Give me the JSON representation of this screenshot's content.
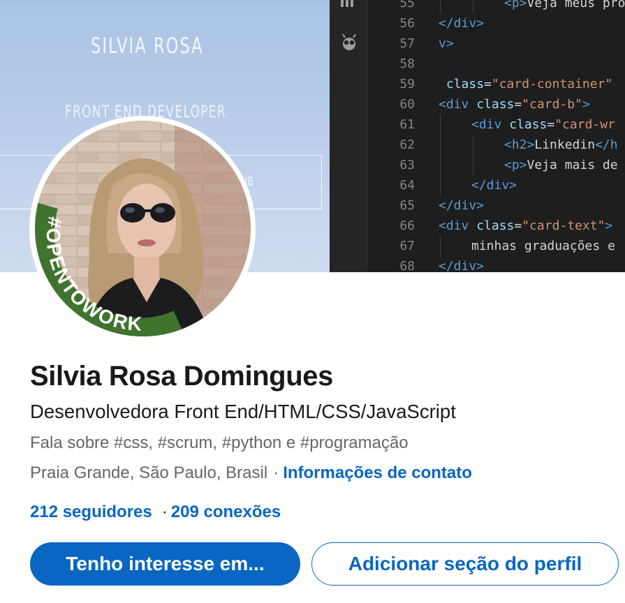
{
  "banner": {
    "name": "SILVIA ROSA",
    "role": "FRONT END DEVELOPER",
    "box_text": "UB",
    "code_lines": [
      {
        "num": "55",
        "indent": 2,
        "parts": [
          [
            "tag",
            "<"
          ],
          [
            "tag",
            "p"
          ],
          [
            "tag",
            ">"
          ],
          [
            "txt",
            "Veja meus projet"
          ]
        ]
      },
      {
        "num": "56",
        "indent": 0,
        "parts": [
          [
            "tag",
            "</div>"
          ]
        ]
      },
      {
        "num": "57",
        "indent": 0,
        "parts": [
          [
            "tag",
            "v>"
          ]
        ]
      },
      {
        "num": "58",
        "indent": 0,
        "parts": []
      },
      {
        "num": "59",
        "indent": 0,
        "parts": [
          [
            "txt",
            " "
          ],
          [
            "attr",
            "class"
          ],
          [
            "txt",
            "="
          ],
          [
            "str",
            "\"card-container\""
          ]
        ]
      },
      {
        "num": "60",
        "indent": 0,
        "parts": [
          [
            "tag",
            "<div "
          ],
          [
            "attr",
            "class"
          ],
          [
            "txt",
            "="
          ],
          [
            "str",
            "\"card-b\""
          ],
          [
            "tag",
            ">"
          ]
        ]
      },
      {
        "num": "61",
        "indent": 1,
        "parts": [
          [
            "tag",
            "<div "
          ],
          [
            "attr",
            "class"
          ],
          [
            "txt",
            "="
          ],
          [
            "str",
            "\"card-wr"
          ]
        ]
      },
      {
        "num": "62",
        "indent": 2,
        "parts": [
          [
            "tag",
            "<h2>"
          ],
          [
            "txt",
            "Linkedin"
          ],
          [
            "tag",
            "</h"
          ]
        ]
      },
      {
        "num": "63",
        "indent": 2,
        "parts": [
          [
            "tag",
            "<p>"
          ],
          [
            "txt",
            "Veja mais de"
          ]
        ]
      },
      {
        "num": "64",
        "indent": 1,
        "parts": [
          [
            "tag",
            "</div>"
          ]
        ]
      },
      {
        "num": "65",
        "indent": 0,
        "parts": [
          [
            "tag",
            "</div>"
          ]
        ]
      },
      {
        "num": "66",
        "indent": 0,
        "parts": [
          [
            "tag",
            "<div "
          ],
          [
            "attr",
            "class"
          ],
          [
            "txt",
            "="
          ],
          [
            "str",
            "\"card-text\""
          ],
          [
            "tag",
            ">"
          ]
        ]
      },
      {
        "num": "67",
        "indent": 1,
        "parts": [
          [
            "txt",
            "minhas graduações e"
          ]
        ]
      },
      {
        "num": "68",
        "indent": 0,
        "parts": [
          [
            "tag",
            "</div>"
          ]
        ]
      }
    ]
  },
  "avatar": {
    "badge_text": "#OPENTOWORK",
    "badge_color": "#40742e"
  },
  "profile": {
    "name": "Silvia Rosa Domingues",
    "headline": "Desenvolvedora Front End/HTML/CSS/JavaScript",
    "topics": "Fala sobre #css, #scrum, #python e #programação",
    "location": "Praia Grande, São Paulo, Brasil",
    "separator": "·",
    "contact_link": "Informações de contato",
    "followers": "212 seguidores",
    "network_separator": "·",
    "connections": "209 conexões"
  },
  "actions": {
    "primary_label": "Tenho interesse em...",
    "secondary_label": "Adicionar seção do perfil"
  },
  "colors": {
    "brand": "#0a66c2",
    "text_primary": "#191919",
    "text_secondary": "#666666"
  }
}
